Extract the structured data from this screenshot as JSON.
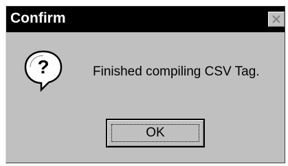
{
  "window": {
    "title": "Confirm",
    "close_icon": "close-icon"
  },
  "content": {
    "icon": "question-icon",
    "message": "Finished compiling CSV Tag."
  },
  "buttons": {
    "ok_label": "OK"
  },
  "colors": {
    "titlebar": "#000000",
    "title_text": "#ffffff",
    "dialog_face": "#c0c0c0"
  }
}
